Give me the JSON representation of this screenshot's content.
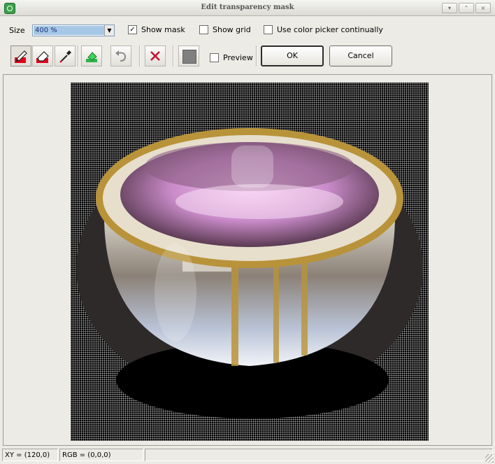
{
  "window": {
    "title": "Edit transparency mask",
    "buttons": [
      "▾",
      "⌃",
      "×"
    ]
  },
  "options": {
    "size_label": "Size",
    "size_value": "400 %",
    "show_mask": {
      "label": "Show mask",
      "checked": true
    },
    "show_grid": {
      "label": "Show grid",
      "checked": false
    },
    "color_picker": {
      "label": "Use color picker continually",
      "checked": false
    }
  },
  "toolbar": {
    "tools": [
      "pencil-tool",
      "eraser-tool",
      "eyedropper-tool",
      "fill-tool",
      "undo-tool",
      "clear-tool",
      "mask-color-swatch"
    ],
    "preview": {
      "label": "Preview",
      "checked": false
    },
    "ok_label": "OK",
    "cancel_label": "Cancel"
  },
  "status": {
    "xy": "XY = (120,0)",
    "rgb": "RGB = (0,0,0)"
  },
  "colors": {
    "accent": "#e3001b",
    "selection": "#a6c8e6",
    "mask_color": "#808080"
  }
}
